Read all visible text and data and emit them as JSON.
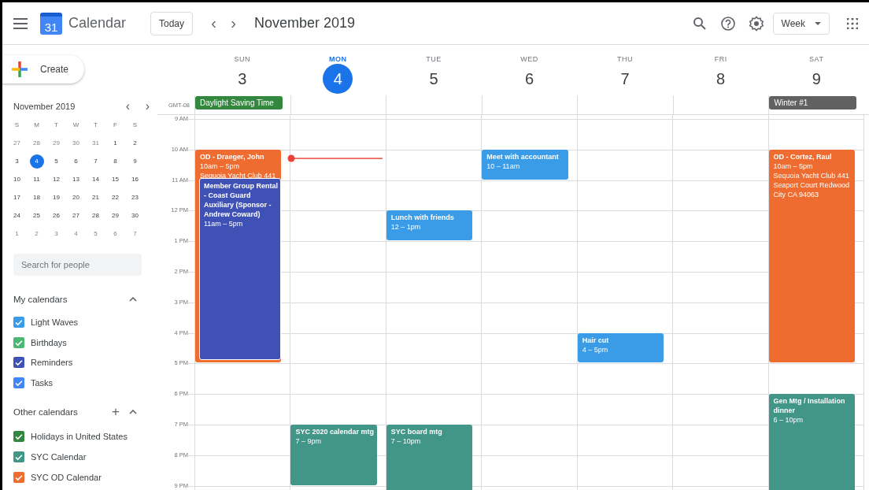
{
  "app": {
    "name": "Calendar",
    "logo_day": "31"
  },
  "toolbar": {
    "today": "Today",
    "prev": "‹",
    "next": "›",
    "title": "November 2019",
    "view": "Week"
  },
  "create": {
    "label": "Create"
  },
  "mini_calendar": {
    "title": "November 2019",
    "prev": "‹",
    "next": "›",
    "weekdays": [
      "S",
      "M",
      "T",
      "W",
      "T",
      "F",
      "S"
    ],
    "weeks": [
      [
        {
          "label": "27",
          "other_month": true,
          "selected": false
        },
        {
          "label": "28",
          "other_month": true,
          "selected": false
        },
        {
          "label": "29",
          "other_month": true,
          "selected": false
        },
        {
          "label": "30",
          "other_month": true,
          "selected": false
        },
        {
          "label": "31",
          "other_month": true,
          "selected": false
        },
        {
          "label": "1",
          "other_month": false,
          "selected": false
        },
        {
          "label": "2",
          "other_month": false,
          "selected": false
        }
      ],
      [
        {
          "label": "3",
          "other_month": false,
          "selected": false
        },
        {
          "label": "4",
          "other_month": false,
          "selected": true
        },
        {
          "label": "5",
          "other_month": false,
          "selected": false
        },
        {
          "label": "6",
          "other_month": false,
          "selected": false
        },
        {
          "label": "7",
          "other_month": false,
          "selected": false
        },
        {
          "label": "8",
          "other_month": false,
          "selected": false
        },
        {
          "label": "9",
          "other_month": false,
          "selected": false
        }
      ],
      [
        {
          "label": "10",
          "other_month": false,
          "selected": false
        },
        {
          "label": "11",
          "other_month": false,
          "selected": false
        },
        {
          "label": "12",
          "other_month": false,
          "selected": false
        },
        {
          "label": "13",
          "other_month": false,
          "selected": false
        },
        {
          "label": "14",
          "other_month": false,
          "selected": false
        },
        {
          "label": "15",
          "other_month": false,
          "selected": false
        },
        {
          "label": "16",
          "other_month": false,
          "selected": false
        }
      ],
      [
        {
          "label": "17",
          "other_month": false,
          "selected": false
        },
        {
          "label": "18",
          "other_month": false,
          "selected": false
        },
        {
          "label": "19",
          "other_month": false,
          "selected": false
        },
        {
          "label": "20",
          "other_month": false,
          "selected": false
        },
        {
          "label": "21",
          "other_month": false,
          "selected": false
        },
        {
          "label": "22",
          "other_month": false,
          "selected": false
        },
        {
          "label": "23",
          "other_month": false,
          "selected": false
        }
      ],
      [
        {
          "label": "24",
          "other_month": false,
          "selected": false
        },
        {
          "label": "25",
          "other_month": false,
          "selected": false
        },
        {
          "label": "26",
          "other_month": false,
          "selected": false
        },
        {
          "label": "27",
          "other_month": false,
          "selected": false
        },
        {
          "label": "28",
          "other_month": false,
          "selected": false
        },
        {
          "label": "29",
          "other_month": false,
          "selected": false
        },
        {
          "label": "30",
          "other_month": false,
          "selected": false
        }
      ],
      [
        {
          "label": "1",
          "other_month": true,
          "selected": false
        },
        {
          "label": "2",
          "other_month": true,
          "selected": false
        },
        {
          "label": "3",
          "other_month": true,
          "selected": false
        },
        {
          "label": "4",
          "other_month": true,
          "selected": false
        },
        {
          "label": "5",
          "other_month": true,
          "selected": false
        },
        {
          "label": "6",
          "other_month": true,
          "selected": false
        },
        {
          "label": "7",
          "other_month": true,
          "selected": false
        }
      ]
    ]
  },
  "people_search": {
    "placeholder": "Search for people"
  },
  "my_calendars": {
    "title": "My calendars",
    "expanded": true,
    "items": [
      {
        "label": "Light Waves",
        "color": "#3a9be6",
        "checked": true
      },
      {
        "label": "Birthdays",
        "color": "#4cb873",
        "checked": true
      },
      {
        "label": "Reminders",
        "color": "#3f51b5",
        "checked": true
      },
      {
        "label": "Tasks",
        "color": "#4285f4",
        "checked": true
      }
    ]
  },
  "other_calendars": {
    "title": "Other calendars",
    "add": "+",
    "expanded": true,
    "items": [
      {
        "label": "Holidays in United States",
        "color": "#33873f",
        "checked": true
      },
      {
        "label": "SYC Calendar",
        "color": "#419688",
        "checked": true
      },
      {
        "label": "SYC OD Calendar",
        "color": "#ef6c30",
        "checked": true
      }
    ]
  },
  "timezone": "GMT-08",
  "hours": [
    "9 AM",
    "10 AM",
    "11 AM",
    "12 PM",
    "1 PM",
    "2 PM",
    "3 PM",
    "4 PM",
    "5 PM",
    "6 PM",
    "7 PM",
    "8 PM",
    "9 PM"
  ],
  "days": [
    {
      "weekday": "SUN",
      "date": "3",
      "selected": false,
      "all_day": [
        {
          "title": "Daylight Saving Time",
          "color": "#33873f"
        }
      ],
      "events": [
        {
          "title": "OD - Draeger, John",
          "time": "10am – 5pm",
          "location": "Sequoia Yacht Club 441",
          "color": "#ef6c30",
          "overlaps": [
            {
              "title": "Member Group Rental - Coast Guard Auxiliary (Sponsor - Andrew Coward)",
              "time": "11am – 5pm",
              "color": "#3f51b5"
            }
          ]
        }
      ]
    },
    {
      "weekday": "MON",
      "date": "4",
      "selected": true,
      "events": [
        {
          "title": "SYC 2020 calendar mtg",
          "time": "7 – 9pm",
          "color": "#419688"
        }
      ]
    },
    {
      "weekday": "TUE",
      "date": "5",
      "selected": false,
      "events": [
        {
          "title": "Lunch with friends",
          "time": "12 – 1pm",
          "color": "#3a9be6"
        },
        {
          "title": "SYC board mtg",
          "time": "7 – 10pm",
          "color": "#419688"
        }
      ]
    },
    {
      "weekday": "WED",
      "date": "6",
      "selected": false,
      "events": [
        {
          "title": "Meet with accountant",
          "time": "10 – 11am",
          "color": "#3a9be6"
        }
      ]
    },
    {
      "weekday": "THU",
      "date": "7",
      "selected": false,
      "events": [
        {
          "title": "Hair cut",
          "time": "4 – 5pm",
          "color": "#3a9be6"
        }
      ]
    },
    {
      "weekday": "FRI",
      "date": "8",
      "selected": false
    },
    {
      "weekday": "SAT",
      "date": "9",
      "selected": false,
      "all_day": [
        {
          "title": "Winter #1",
          "color": "#616161"
        }
      ],
      "events": [
        {
          "title": "OD - Cortez, Raul",
          "time": "10am – 5pm",
          "location": "Sequoia Yacht Club 441 Seaport Court Redwood City CA 94063",
          "color": "#ef6c30"
        },
        {
          "title": "Gen Mtg / Installation dinner",
          "time": "6 – 10pm",
          "color": "#419688"
        }
      ]
    }
  ]
}
